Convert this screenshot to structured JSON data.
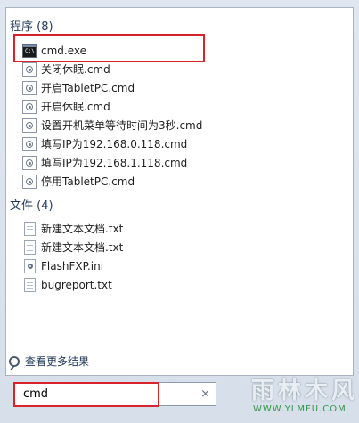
{
  "sections": {
    "programs_header": "程序 (8)",
    "files_header": "文件 (4)"
  },
  "programs": [
    {
      "label": "cmd.exe",
      "icon": "cmd-icon"
    },
    {
      "label": "关闭休眠.cmd",
      "icon": "script-icon"
    },
    {
      "label": "开启TabletPC.cmd",
      "icon": "script-icon"
    },
    {
      "label": "开启休眠.cmd",
      "icon": "script-icon"
    },
    {
      "label": "设置开机菜单等待时间为3秒.cmd",
      "icon": "script-icon"
    },
    {
      "label": "填写IP为192.168.0.118.cmd",
      "icon": "script-icon"
    },
    {
      "label": "填写IP为192.168.1.118.cmd",
      "icon": "script-icon"
    },
    {
      "label": "停用TabletPC.cmd",
      "icon": "script-icon"
    }
  ],
  "files": [
    {
      "label": "新建文本文档.txt",
      "icon": "text-document-icon"
    },
    {
      "label": "新建文本文档.txt",
      "icon": "text-document-icon"
    },
    {
      "label": "FlashFXP.ini",
      "icon": "settings-file-icon"
    },
    {
      "label": "bugreport.txt",
      "icon": "text-document-icon"
    }
  ],
  "see_more": "查看更多结果",
  "search": {
    "value": "cmd",
    "clear_glyph": "×"
  },
  "watermark": {
    "line1": "雨林木风",
    "line2": "WWW.YLMFU.COM"
  },
  "colors": {
    "highlight": "#d9232a",
    "section_text": "#1e395b"
  }
}
